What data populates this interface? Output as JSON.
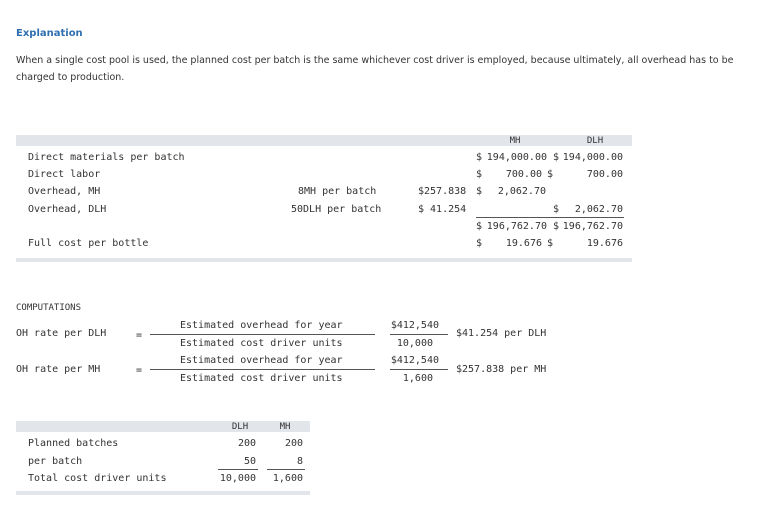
{
  "explanation": {
    "title": "Explanation",
    "text": "When a single cost pool is used, the planned cost per batch is the same whichever cost driver is employed, because ultimately, all overhead has to be charged to production."
  },
  "cost_table": {
    "col_mh": "MH",
    "col_dlh": "DLH",
    "rows": [
      {
        "label": "Direct materials per batch",
        "rate": "",
        "rate_value": "",
        "mh_cur": "$",
        "mh": "194,000.00",
        "dlh_cur": "$",
        "dlh": "194,000.00"
      },
      {
        "label": "Direct labor",
        "rate": "",
        "rate_value": "",
        "mh_cur": "$",
        "mh": "700.00",
        "dlh_cur": "$",
        "dlh": "700.00"
      },
      {
        "label": "Overhead, MH",
        "rate": "8MH per batch",
        "rate_value": "$257.838",
        "mh_cur": "$",
        "mh": "2,062.70",
        "dlh_cur": "",
        "dlh": ""
      },
      {
        "label": "Overhead, DLH",
        "rate": "50DLH per batch",
        "rate_value": "$ 41.254",
        "mh_cur": "",
        "mh": "",
        "dlh_cur": "$",
        "dlh": "2,062.70"
      }
    ],
    "subtotal": {
      "mh_cur": "$",
      "mh": "196,762.70",
      "dlh_cur": "$",
      "dlh": "196,762.70"
    },
    "full_cost": {
      "label": "Full cost per bottle",
      "mh_cur": "$",
      "mh": "19.676",
      "dlh_cur": "$",
      "dlh": "19.676"
    }
  },
  "computations": {
    "heading": "COMPUTATIONS",
    "rows": [
      {
        "label": "OH rate per DLH",
        "eq": "=",
        "num_label": "Estimated overhead for year",
        "den_label": "Estimated cost driver units",
        "num": "$412,540",
        "den": "10,000",
        "result": "$41.254 per DLH"
      },
      {
        "label": "OH rate per MH",
        "eq": "=",
        "num_label": "Estimated overhead for year",
        "den_label": "Estimated cost driver units",
        "num": "$412,540",
        "den": "1,600",
        "result": "$257.838 per MH"
      }
    ]
  },
  "driver_table": {
    "col_dlh": "DLH",
    "col_mh": "MH",
    "rows": [
      {
        "label": "Planned batches",
        "dlh": "200",
        "mh": "200"
      },
      {
        "label": "per batch",
        "dlh": "50",
        "mh": "8"
      },
      {
        "label": "Total cost driver units",
        "dlh": "10,000",
        "mh": "1,600"
      }
    ]
  }
}
